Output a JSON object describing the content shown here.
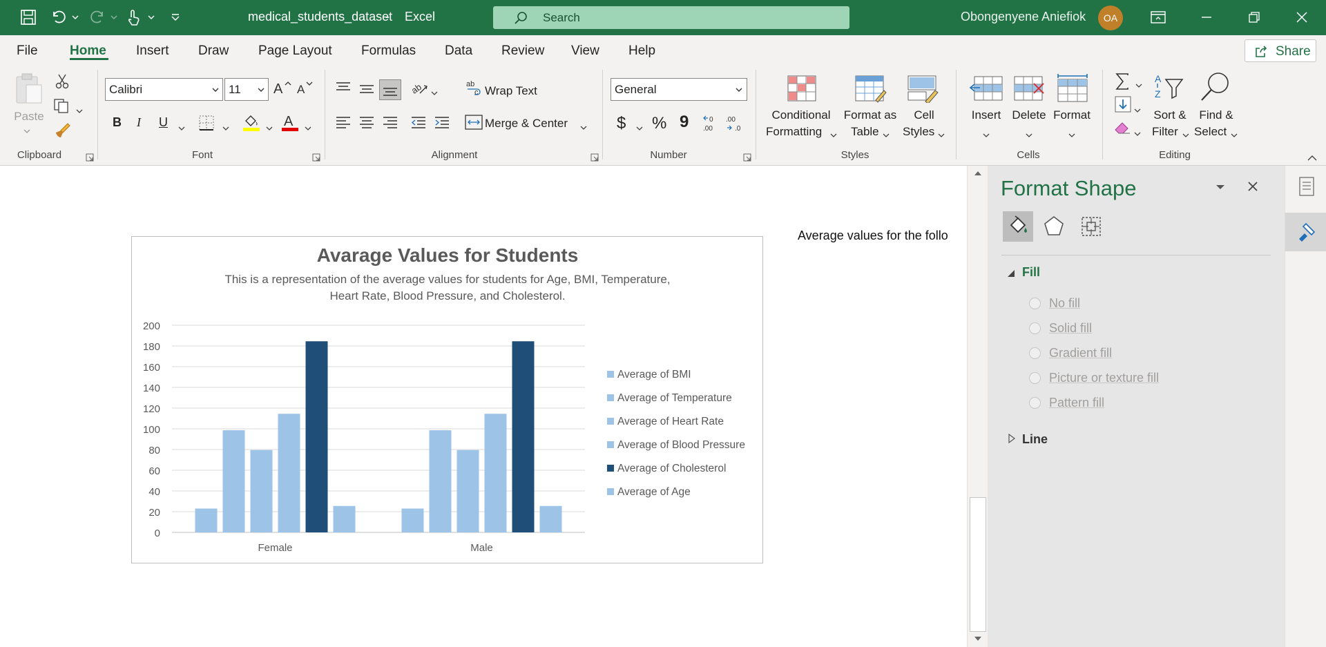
{
  "titlebar": {
    "filename": "medical_students_dataset",
    "app": "Excel",
    "search_placeholder": "Search",
    "user_name": "Obongenyene Aniefiok",
    "user_initials": "OA"
  },
  "menu": {
    "tabs": [
      "File",
      "Home",
      "Insert",
      "Draw",
      "Page Layout",
      "Formulas",
      "Data",
      "Review",
      "View",
      "Help"
    ],
    "active": "Home",
    "share_label": "Share"
  },
  "ribbon": {
    "clipboard": {
      "paste": "Paste",
      "group": "Clipboard"
    },
    "font": {
      "name": "Calibri",
      "size": "11",
      "group": "Font",
      "bold": "B",
      "italic": "I",
      "underline": "U"
    },
    "alignment": {
      "wrap_text": "Wrap Text",
      "merge_center": "Merge & Center",
      "group": "Alignment"
    },
    "number": {
      "format": "General",
      "currency": "$",
      "percent": "%",
      "comma": "9",
      "group": "Number"
    },
    "styles": {
      "conditional_1": "Conditional",
      "conditional_2": "Formatting",
      "format_table_1": "Format as",
      "format_table_2": "Table",
      "cell_styles_1": "Cell",
      "cell_styles_2": "Styles",
      "group": "Styles"
    },
    "cells": {
      "insert": "Insert",
      "delete": "Delete",
      "format": "Format",
      "group": "Cells"
    },
    "editing": {
      "sort_1": "Sort &",
      "sort_2": "Filter",
      "find_1": "Find &",
      "find_2": "Select",
      "group": "Editing"
    }
  },
  "sheet": {
    "cell_text": "Average values for the follo"
  },
  "chart_data": {
    "type": "bar",
    "title": "Avarage Values for Students",
    "subtitle_line1": "This is a representation of the average values for students for Age, BMI, Temperature,",
    "subtitle_line2": "Heart Rate, Blood Pressure, and Cholesterol.",
    "categories": [
      "Female",
      "Male"
    ],
    "series": [
      {
        "name": "Average of BMI",
        "values": [
          23,
          23
        ],
        "color": "#9dc3e6"
      },
      {
        "name": "Average of Temperature",
        "values": [
          98.6,
          98.6
        ],
        "color": "#9dc3e6"
      },
      {
        "name": "Average of Heart Rate",
        "values": [
          79.5,
          79.5
        ],
        "color": "#9dc3e6"
      },
      {
        "name": "Average of Blood Pressure",
        "values": [
          114.5,
          114.5
        ],
        "color": "#9dc3e6"
      },
      {
        "name": "Average of Cholesterol",
        "values": [
          184.5,
          184.5
        ],
        "color": "#1f4e79"
      },
      {
        "name": "Average of Age",
        "values": [
          25.5,
          25.5
        ],
        "color": "#9dc3e6"
      }
    ],
    "ylim": [
      0,
      200
    ],
    "yticks": [
      0,
      20,
      40,
      60,
      80,
      100,
      120,
      140,
      160,
      180,
      200
    ],
    "grid": true,
    "legend": "right"
  },
  "pane": {
    "title": "Format Shape",
    "fill_section": "Fill",
    "line_section": "Line",
    "fill_options": [
      "No fill",
      "Solid fill",
      "Gradient fill",
      "Picture or texture fill",
      "Pattern fill"
    ]
  },
  "colors": {
    "excel_green": "#217346",
    "bar_light": "#9dc3e6",
    "bar_dark": "#1f4e79"
  }
}
